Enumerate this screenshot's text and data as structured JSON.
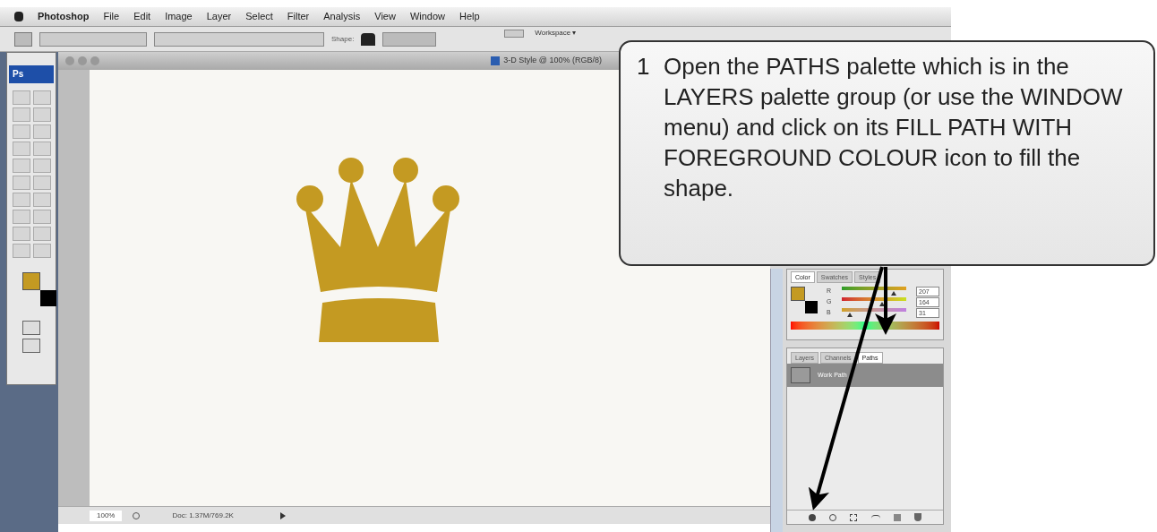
{
  "menu_bar": {
    "items": [
      "Photoshop",
      "File",
      "Edit",
      "Image",
      "Layer",
      "Select",
      "Filter",
      "Analysis",
      "View",
      "Window",
      "Help"
    ]
  },
  "options_bar": {
    "shape_label": "Shape:",
    "workspace": "Workspace ▾"
  },
  "toolbox": {
    "logo": "Ps"
  },
  "document": {
    "title": "3-D Style @ 100% (RGB/8)",
    "zoom": "100%",
    "doc_info": "Doc: 1.37M/769.2K"
  },
  "color_panel": {
    "tabs": [
      {
        "label": "Color",
        "selected": true
      },
      {
        "label": "Swatches",
        "selected": false
      },
      {
        "label": "Styles",
        "selected": false
      }
    ],
    "sliders": [
      {
        "label": "R",
        "level": 0.8,
        "value": "207"
      },
      {
        "label": "G",
        "level": 0.63,
        "value": "164"
      },
      {
        "label": "B",
        "level": 0.12,
        "value": "31"
      }
    ]
  },
  "paths_panel": {
    "tabs": [
      {
        "label": "Layers",
        "selected": false
      },
      {
        "label": "Channels",
        "selected": false
      },
      {
        "label": "Paths",
        "selected": true
      }
    ],
    "paths": [
      {
        "name": "Work Path",
        "selected": true
      }
    ]
  },
  "callout": {
    "number": "1",
    "text": "Open the PATHS palette which is in the LAYERS palette group (or use the WINDOW menu) and click on its FILL PATH WITH FOREGROUND COLOUR icon to fill the shape."
  }
}
